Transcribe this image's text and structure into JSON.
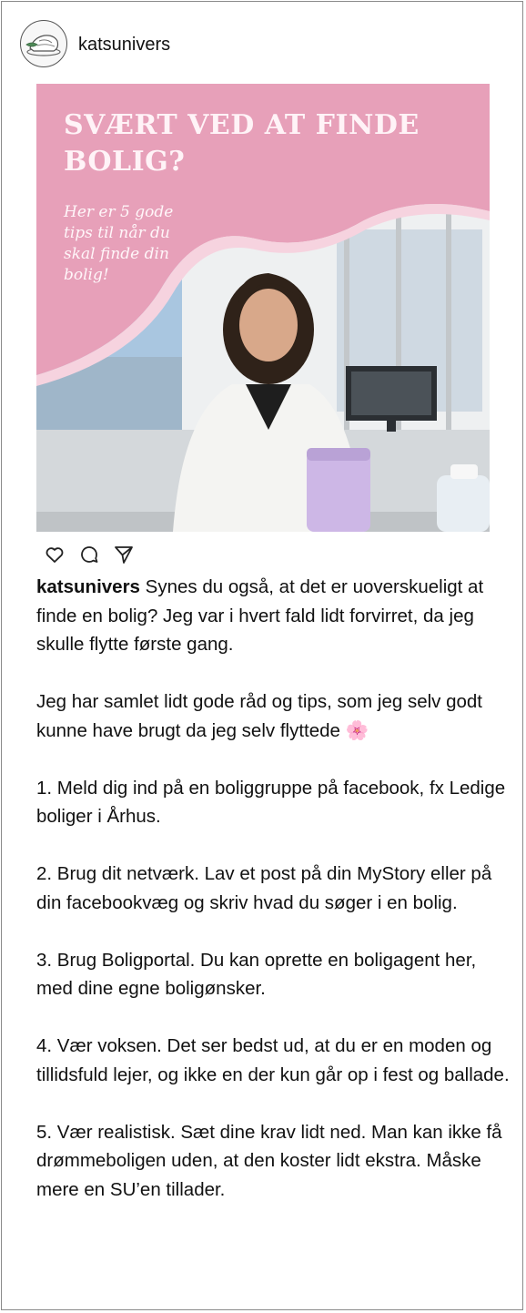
{
  "post": {
    "username": "katsunivers",
    "image": {
      "headline": "SVÆRT VED AT FINDE BOLIG?",
      "subline": "Her er 5 gode tips til når du skal finde din bolig!",
      "background_color": "#e7a0b9"
    },
    "actions": [
      "heart-icon",
      "comment-icon",
      "share-icon"
    ],
    "caption": {
      "username": "katsunivers",
      "intro": "Synes du også, at det er uoverskueligt at finde en bolig? Jeg var i hvert fald lidt forvirret, da jeg skulle flytte første gang.",
      "paragraph2": "Jeg har samlet lidt gode råd og tips, som jeg selv godt kunne have brugt da jeg selv flyttede 🌸",
      "tips": [
        "1. Meld dig ind på en boliggruppe på facebook, fx Ledige boliger i Århus.",
        "2. Brug dit netværk. Lav et post på din MyStory eller på din facebookvæg og skriv hvad du søger i en bolig.",
        "3. Brug Boligportal. Du kan oprette en boligagent her, med dine egne boligønsker.",
        "4. Vær voksen. Det ser bedst ud, at du er en moden og tillidsfuld lejer, og ikke en der kun går op i fest og ballade.",
        "5. Vær realistisk. Sæt dine krav lidt ned. Man kan ikke få drømmeboligen uden, at den koster lidt ekstra. Måske mere en SU’en tillader."
      ]
    }
  }
}
